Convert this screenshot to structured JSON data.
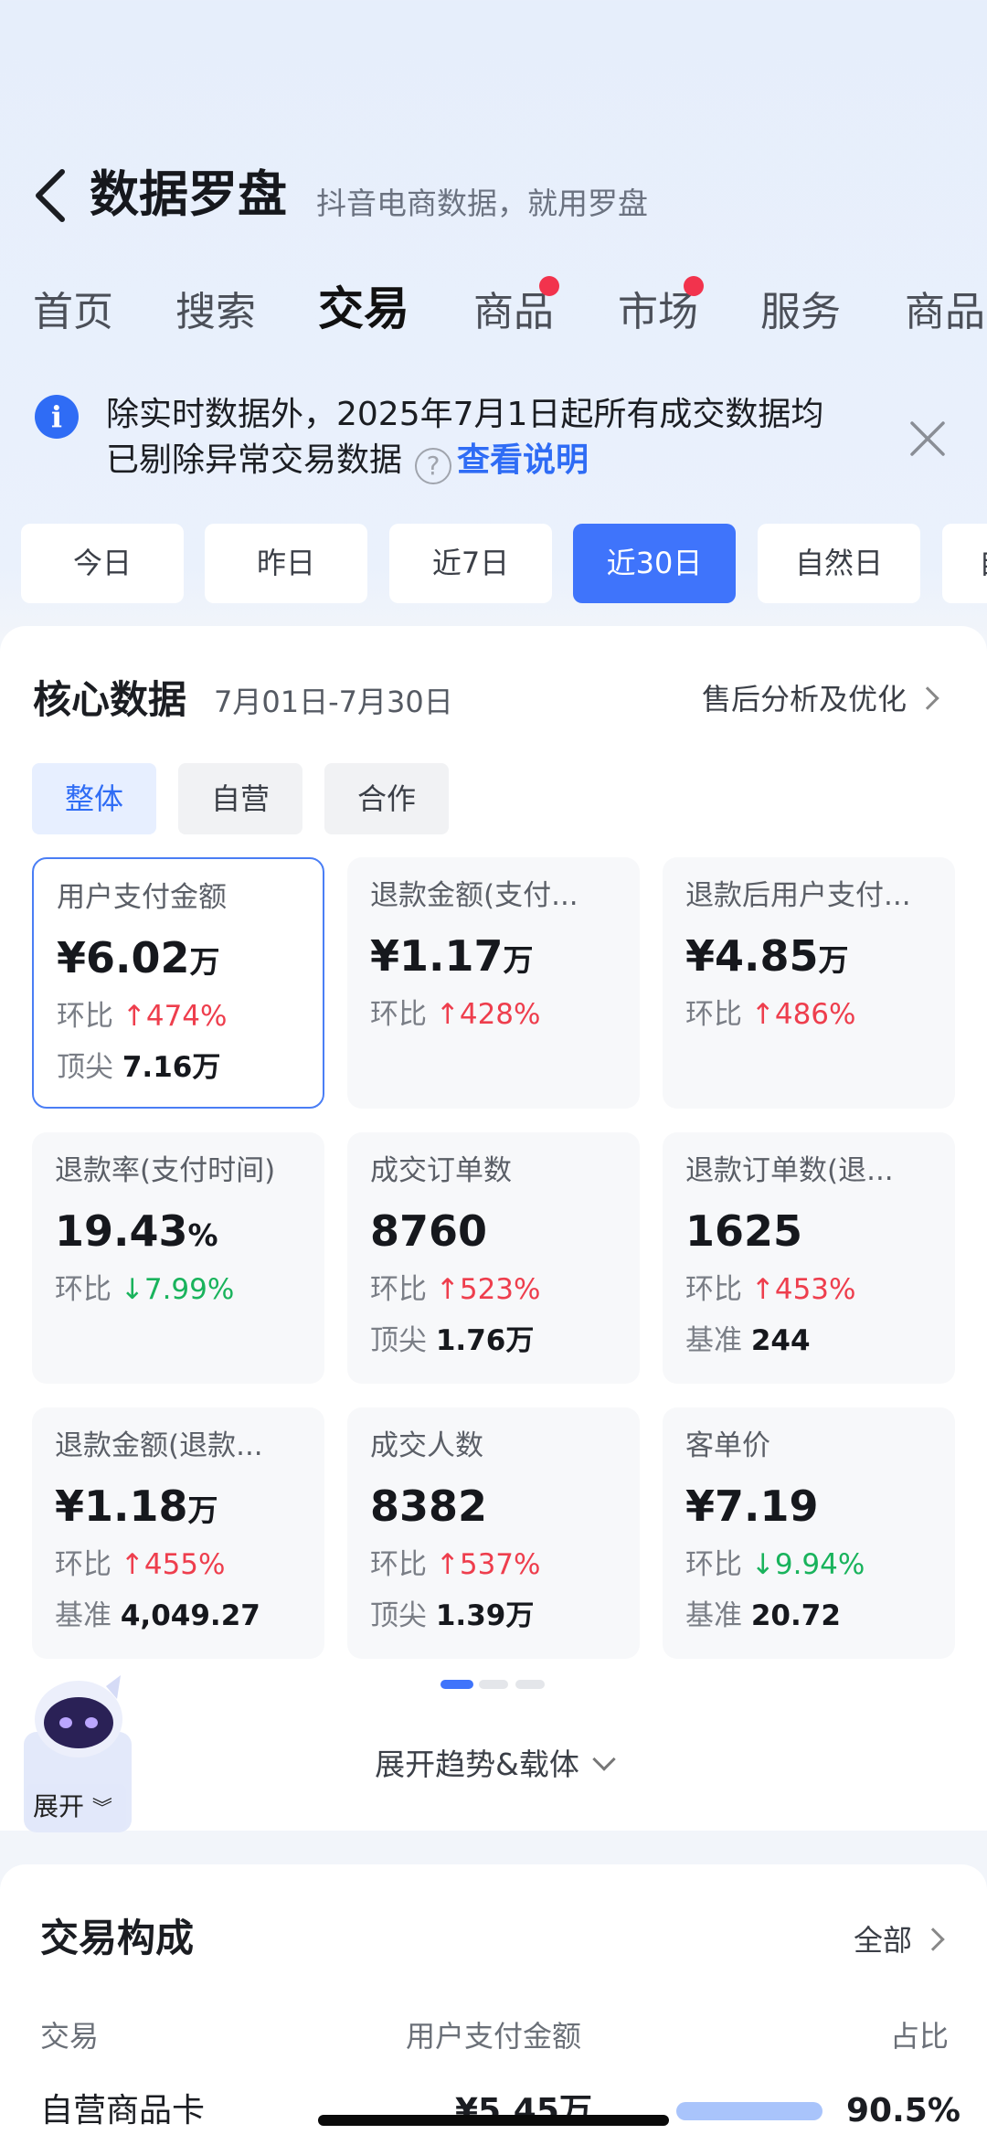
{
  "header": {
    "back_icon": "chevron-left-icon",
    "title": "数据罗盘",
    "subtitle": "抖音电商数据，就用罗盘"
  },
  "tabs": [
    {
      "label": "首页",
      "active": false,
      "dot": false
    },
    {
      "label": "搜索",
      "active": false,
      "dot": false
    },
    {
      "label": "交易",
      "active": true,
      "dot": false
    },
    {
      "label": "商品",
      "active": false,
      "dot": true
    },
    {
      "label": "市场",
      "active": false,
      "dot": true
    },
    {
      "label": "服务",
      "active": false,
      "dot": false
    },
    {
      "label": "商品",
      "active": false,
      "dot": false
    }
  ],
  "notice": {
    "icon": "info-icon",
    "line1": "除实时数据外，2025年7月1日起所有成交数据均",
    "line2": "已剔除异常交易数据",
    "link": "查看说明",
    "close_icon": "close-icon"
  },
  "date_ranges": [
    {
      "label": "今日",
      "active": false
    },
    {
      "label": "昨日",
      "active": false
    },
    {
      "label": "近7日",
      "active": false
    },
    {
      "label": "近30日",
      "active": true
    },
    {
      "label": "自然日",
      "active": false
    },
    {
      "label": "自",
      "active": false
    }
  ],
  "core": {
    "title": "核心数据",
    "date_range": "7月01日-7月30日",
    "link": "售后分析及优化",
    "segments": [
      {
        "label": "整体",
        "active": true
      },
      {
        "label": "自营",
        "active": false
      },
      {
        "label": "合作",
        "active": false
      }
    ],
    "metrics": [
      {
        "label": "用户支付金额",
        "value": "¥6.02",
        "unit": "万",
        "cmp_label": "环比",
        "cmp_dir": "up",
        "cmp": "474%",
        "extra_label": "顶尖",
        "extra_value": "7.16万",
        "selected": true
      },
      {
        "label": "退款金额(支付...",
        "value": "¥1.17",
        "unit": "万",
        "cmp_label": "环比",
        "cmp_dir": "up",
        "cmp": "428%",
        "extra_label": "",
        "extra_value": "",
        "selected": false
      },
      {
        "label": "退款后用户支付...",
        "value": "¥4.85",
        "unit": "万",
        "cmp_label": "环比",
        "cmp_dir": "up",
        "cmp": "486%",
        "extra_label": "",
        "extra_value": "",
        "selected": false
      },
      {
        "label": "退款率(支付时间)",
        "value": "19.43",
        "unit": "%",
        "cmp_label": "环比",
        "cmp_dir": "down",
        "cmp": "7.99%",
        "extra_label": "",
        "extra_value": "",
        "selected": false
      },
      {
        "label": "成交订单数",
        "value": "8760",
        "unit": "",
        "cmp_label": "环比",
        "cmp_dir": "up",
        "cmp": "523%",
        "extra_label": "顶尖",
        "extra_value": "1.76万",
        "selected": false
      },
      {
        "label": "退款订单数(退...",
        "value": "1625",
        "unit": "",
        "cmp_label": "环比",
        "cmp_dir": "up",
        "cmp": "453%",
        "extra_label": "基准",
        "extra_value": "244",
        "selected": false
      },
      {
        "label": "退款金额(退款...",
        "value": "¥1.18",
        "unit": "万",
        "cmp_label": "环比",
        "cmp_dir": "up",
        "cmp": "455%",
        "extra_label": "基准",
        "extra_value": "4,049.27",
        "selected": false
      },
      {
        "label": "成交人数",
        "value": "8382",
        "unit": "",
        "cmp_label": "环比",
        "cmp_dir": "up",
        "cmp": "537%",
        "extra_label": "顶尖",
        "extra_value": "1.39万",
        "selected": false
      },
      {
        "label": "客单价",
        "value": "¥7.19",
        "unit": "",
        "cmp_label": "环比",
        "cmp_dir": "down",
        "cmp": "9.94%",
        "extra_label": "基准",
        "extra_value": "20.72",
        "selected": false
      }
    ],
    "pager": {
      "pages": 3,
      "current": 1
    },
    "expand": "展开趋势&载体"
  },
  "assistant": {
    "icon": "robot-assistant-icon",
    "label": "展开"
  },
  "composition": {
    "title": "交易构成",
    "link": "全部",
    "headers": {
      "col1": "交易",
      "col2": "用户支付金额",
      "col3": "占比"
    },
    "rows": [
      {
        "name": "自营商品卡",
        "amount": "¥5.45万",
        "ratio": "90.5%",
        "ratio_value": 0.905
      }
    ]
  },
  "colors": {
    "accent": "#3f74fb",
    "up": "#ee3e4d",
    "down": "#19b35c",
    "badge": "#f2334d"
  }
}
